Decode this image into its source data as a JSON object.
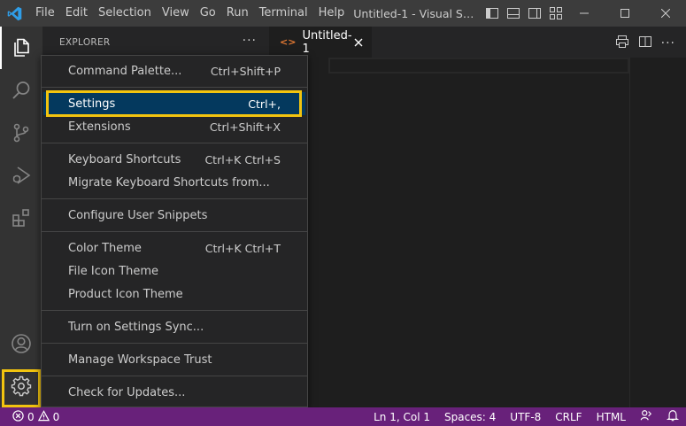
{
  "titlebar": {
    "menus": [
      "File",
      "Edit",
      "Selection",
      "View",
      "Go",
      "Run",
      "Terminal",
      "Help"
    ],
    "title": "Untitled-1 - Visual Studio ..."
  },
  "sidebar": {
    "header": "EXPLORER",
    "more": "···"
  },
  "tab": {
    "label": "Untitled-1",
    "icon": "<>"
  },
  "context_menu": {
    "groups": [
      [
        {
          "label": "Command Palette...",
          "keybinding": "Ctrl+Shift+P"
        }
      ],
      [
        {
          "label": "Settings",
          "keybinding": "Ctrl+,"
        },
        {
          "label": "Extensions",
          "keybinding": "Ctrl+Shift+X"
        }
      ],
      [
        {
          "label": "Keyboard Shortcuts",
          "keybinding": "Ctrl+K Ctrl+S"
        },
        {
          "label": "Migrate Keyboard Shortcuts from...",
          "keybinding": ""
        }
      ],
      [
        {
          "label": "Configure User Snippets",
          "keybinding": ""
        }
      ],
      [
        {
          "label": "Color Theme",
          "keybinding": "Ctrl+K Ctrl+T"
        },
        {
          "label": "File Icon Theme",
          "keybinding": ""
        },
        {
          "label": "Product Icon Theme",
          "keybinding": ""
        }
      ],
      [
        {
          "label": "Turn on Settings Sync...",
          "keybinding": ""
        }
      ],
      [
        {
          "label": "Manage Workspace Trust",
          "keybinding": ""
        }
      ],
      [
        {
          "label": "Check for Updates...",
          "keybinding": ""
        }
      ]
    ]
  },
  "statusbar": {
    "errors": "0",
    "warnings": "0",
    "position": "Ln 1, Col 1",
    "spaces": "Spaces: 4",
    "encoding": "UTF-8",
    "eol": "CRLF",
    "language": "HTML"
  },
  "colors": {
    "statusbar": "#68217a",
    "highlight": "#f2c40f",
    "selection": "#04395e"
  }
}
